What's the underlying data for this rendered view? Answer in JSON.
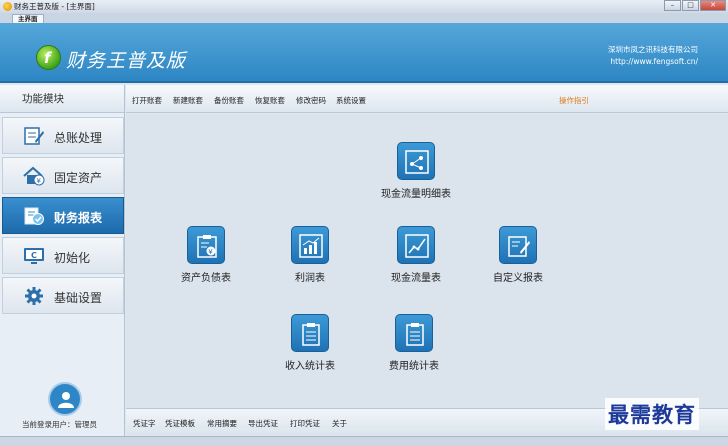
{
  "window": {
    "title": "财务王普及版 - [主界面]",
    "tab": "主界面"
  },
  "banner": {
    "app_title": "财务王普及版",
    "company": "深圳市凤之讯科技有限公司",
    "website": "http://www.fengsoft.cn/"
  },
  "sidebar": {
    "header": "功能模块",
    "items": [
      {
        "label": "总账处理",
        "icon": "ledger-icon"
      },
      {
        "label": "固定资产",
        "icon": "house-yen-icon"
      },
      {
        "label": "财务报表",
        "icon": "report-check-icon",
        "active": true
      },
      {
        "label": "初始化",
        "icon": "monitor-init-icon"
      },
      {
        "label": "基础设置",
        "icon": "gear-icon"
      }
    ],
    "user_label": "当前登录用户：管理员"
  },
  "toolbar": {
    "items": [
      "打开账套",
      "新建账套",
      "备份账套",
      "恢复账套",
      "修改密码",
      "系统设置"
    ],
    "guide": "操作指引"
  },
  "functions": {
    "cashflow_detail": "现金流量明细表",
    "balance_sheet": "资产负债表",
    "income": "利润表",
    "cashflow": "现金流量表",
    "custom_report": "自定义报表",
    "revenue_stats": "收入统计表",
    "expense_stats": "费用统计表"
  },
  "bottombar": {
    "items": [
      "凭证字",
      "凭证模板",
      "常用摘要",
      "导出凭证",
      "打印凭证",
      "关于"
    ]
  },
  "watermark": "最需教育",
  "colors": {
    "banner": "#2d86c4",
    "accent": "#1f72b4",
    "guide": "#e07a18"
  }
}
